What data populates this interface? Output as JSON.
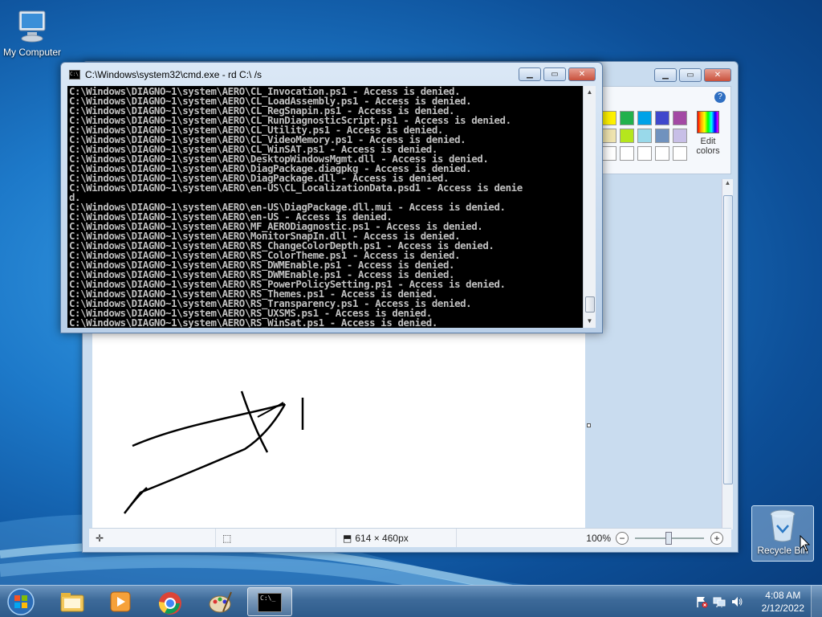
{
  "desktop": {
    "icons": [
      {
        "label": "My Computer",
        "icon": "computer-icon"
      },
      {
        "label": "Recycle Bin",
        "icon": "recycle-bin-icon"
      }
    ]
  },
  "paint": {
    "edit_colors_label": "Edit colors",
    "help_label": "?",
    "statusbar": {
      "canvas_size": "614 × 460px",
      "zoom": "100%",
      "zoom_out": "−",
      "zoom_in": "+"
    },
    "palette_colors": [
      "#fff200",
      "#22b14c",
      "#00a2e8",
      "#3f48cc",
      "#a349a4",
      "#efe4b0",
      "#b5e61d",
      "#99d9ea",
      "#7092be",
      "#c8bfe7",
      "#ffffff",
      "#ffffff",
      "#ffffff",
      "#ffffff",
      "#ffffff"
    ]
  },
  "cmd": {
    "title": "C:\\Windows\\system32\\cmd.exe - rd  C:\\ /s",
    "lines": [
      "C:\\Windows\\DIAGNO~1\\system\\AERO\\CL_Invocation.ps1 - Access is denied.",
      "C:\\Windows\\DIAGNO~1\\system\\AERO\\CL_LoadAssembly.ps1 - Access is denied.",
      "C:\\Windows\\DIAGNO~1\\system\\AERO\\CL_RegSnapin.ps1 - Access is denied.",
      "C:\\Windows\\DIAGNO~1\\system\\AERO\\CL_RunDiagnosticScript.ps1 - Access is denied.",
      "C:\\Windows\\DIAGNO~1\\system\\AERO\\CL_Utility.ps1 - Access is denied.",
      "C:\\Windows\\DIAGNO~1\\system\\AERO\\CL_VideoMemory.ps1 - Access is denied.",
      "C:\\Windows\\DIAGNO~1\\system\\AERO\\CL_WinSAT.ps1 - Access is denied.",
      "C:\\Windows\\DIAGNO~1\\system\\AERO\\DesktopWindowsMgmt.dll - Access is denied.",
      "C:\\Windows\\DIAGNO~1\\system\\AERO\\DiagPackage.diagpkg - Access is denied.",
      "C:\\Windows\\DIAGNO~1\\system\\AERO\\DiagPackage.dll - Access is denied.",
      "C:\\Windows\\DIAGNO~1\\system\\AERO\\en-US\\CL_LocalizationData.psd1 - Access is denie",
      "d.",
      "C:\\Windows\\DIAGNO~1\\system\\AERO\\en-US\\DiagPackage.dll.mui - Access is denied.",
      "C:\\Windows\\DIAGNO~1\\system\\AERO\\en-US - Access is denied.",
      "C:\\Windows\\DIAGNO~1\\system\\AERO\\MF_AERODiagnostic.ps1 - Access is denied.",
      "C:\\Windows\\DIAGNO~1\\system\\AERO\\MonitorSnapIn.dll - Access is denied.",
      "C:\\Windows\\DIAGNO~1\\system\\AERO\\RS_ChangeColorDepth.ps1 - Access is denied.",
      "C:\\Windows\\DIAGNO~1\\system\\AERO\\RS_ColorTheme.ps1 - Access is denied.",
      "C:\\Windows\\DIAGNO~1\\system\\AERO\\RS_DWMEnable.ps1 - Access is denied.",
      "C:\\Windows\\DIAGNO~1\\system\\AERO\\RS_DWMEnable.ps1 - Access is denied.",
      "C:\\Windows\\DIAGNO~1\\system\\AERO\\RS_PowerPolicySetting.ps1 - Access is denied.",
      "C:\\Windows\\DIAGNO~1\\system\\AERO\\RS_Themes.ps1 - Access is denied.",
      "C:\\Windows\\DIAGNO~1\\system\\AERO\\RS_Transparency.ps1 - Access is denied.",
      "C:\\Windows\\DIAGNO~1\\system\\AERO\\RS_UXSMS.ps1 - Access is denied.",
      "C:\\Windows\\DIAGNO~1\\system\\AERO\\RS_WinSat.ps1 - Access is denied."
    ]
  },
  "taskbar": {
    "items": [
      "start-orb-icon",
      "file-explorer-icon",
      "media-player-icon",
      "chrome-icon",
      "paint-icon",
      "command-prompt-icon"
    ],
    "active_item": "command-prompt-icon",
    "cmd_icon_text": "C:\\_"
  },
  "tray": {
    "time": "4:08 AM",
    "date": "2/12/2022"
  }
}
